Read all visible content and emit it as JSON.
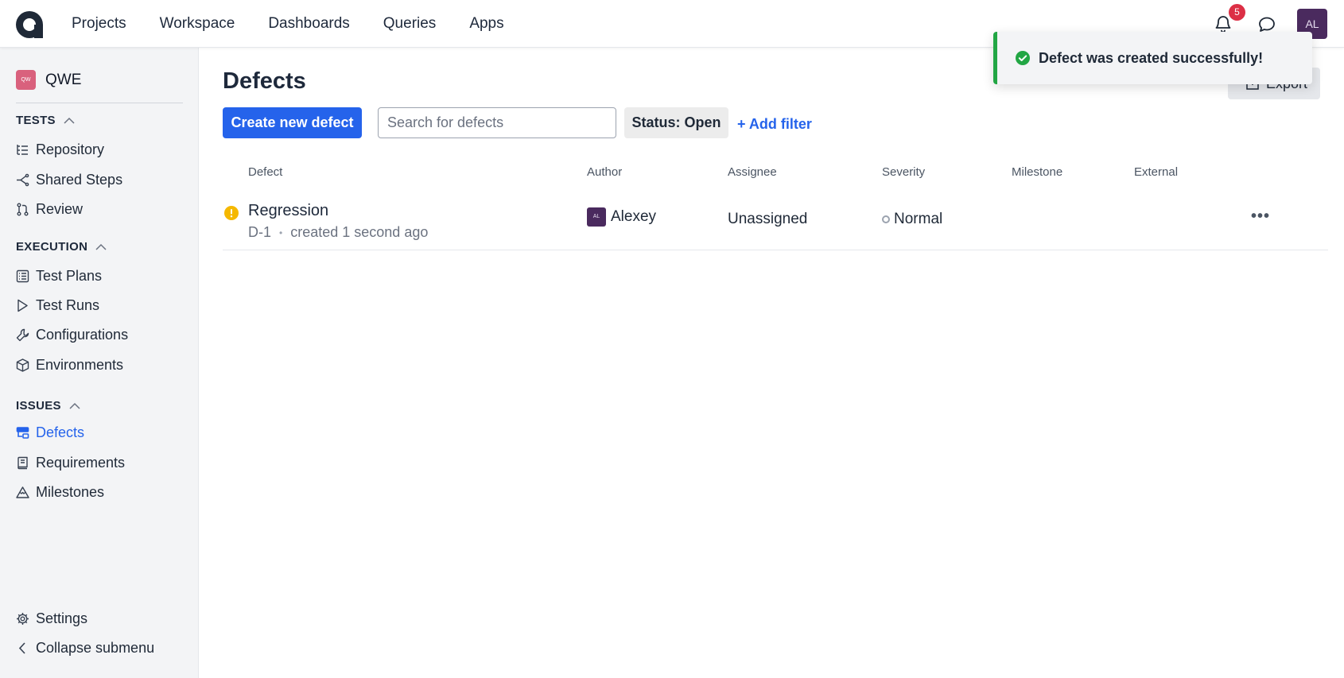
{
  "topnav": {
    "items": [
      "Projects",
      "Workspace",
      "Dashboards",
      "Queries",
      "Apps"
    ],
    "notifications_count": "5",
    "user_initials": "AL"
  },
  "sidebar": {
    "project_icon_text": "QW",
    "project_name": "QWE",
    "sections": {
      "tests": "TESTS",
      "execution": "EXECUTION",
      "issues": "ISSUES"
    },
    "items": {
      "repository": "Repository",
      "shared_steps": "Shared Steps",
      "review": "Review",
      "test_plans": "Test Plans",
      "test_runs": "Test Runs",
      "configurations": "Configurations",
      "environments": "Environments",
      "defects": "Defects",
      "requirements": "Requirements",
      "milestones": "Milestones",
      "settings": "Settings",
      "collapse": "Collapse submenu"
    }
  },
  "main": {
    "title": "Defects",
    "create_button": "Create new defect",
    "search_placeholder": "Search for defects",
    "status_filter": "Status: Open",
    "add_filter": "+ Add filter",
    "export": "Export"
  },
  "table": {
    "headers": {
      "defect": "Defect",
      "author": "Author",
      "assignee": "Assignee",
      "severity": "Severity",
      "milestone": "Milestone",
      "external": "External"
    },
    "rows": [
      {
        "title": "Regression",
        "id": "D-1",
        "created": "created 1 second ago",
        "author_initials": "AL",
        "author": "Alexey",
        "assignee": "Unassigned",
        "severity": "Normal"
      }
    ]
  },
  "toast": {
    "message": "Defect was created successfully!"
  },
  "colors": {
    "accent": "#2563eb",
    "success": "#22a644",
    "warning": "#f5b800",
    "avatar": "#4a2a5e",
    "project": "#d9617d"
  }
}
